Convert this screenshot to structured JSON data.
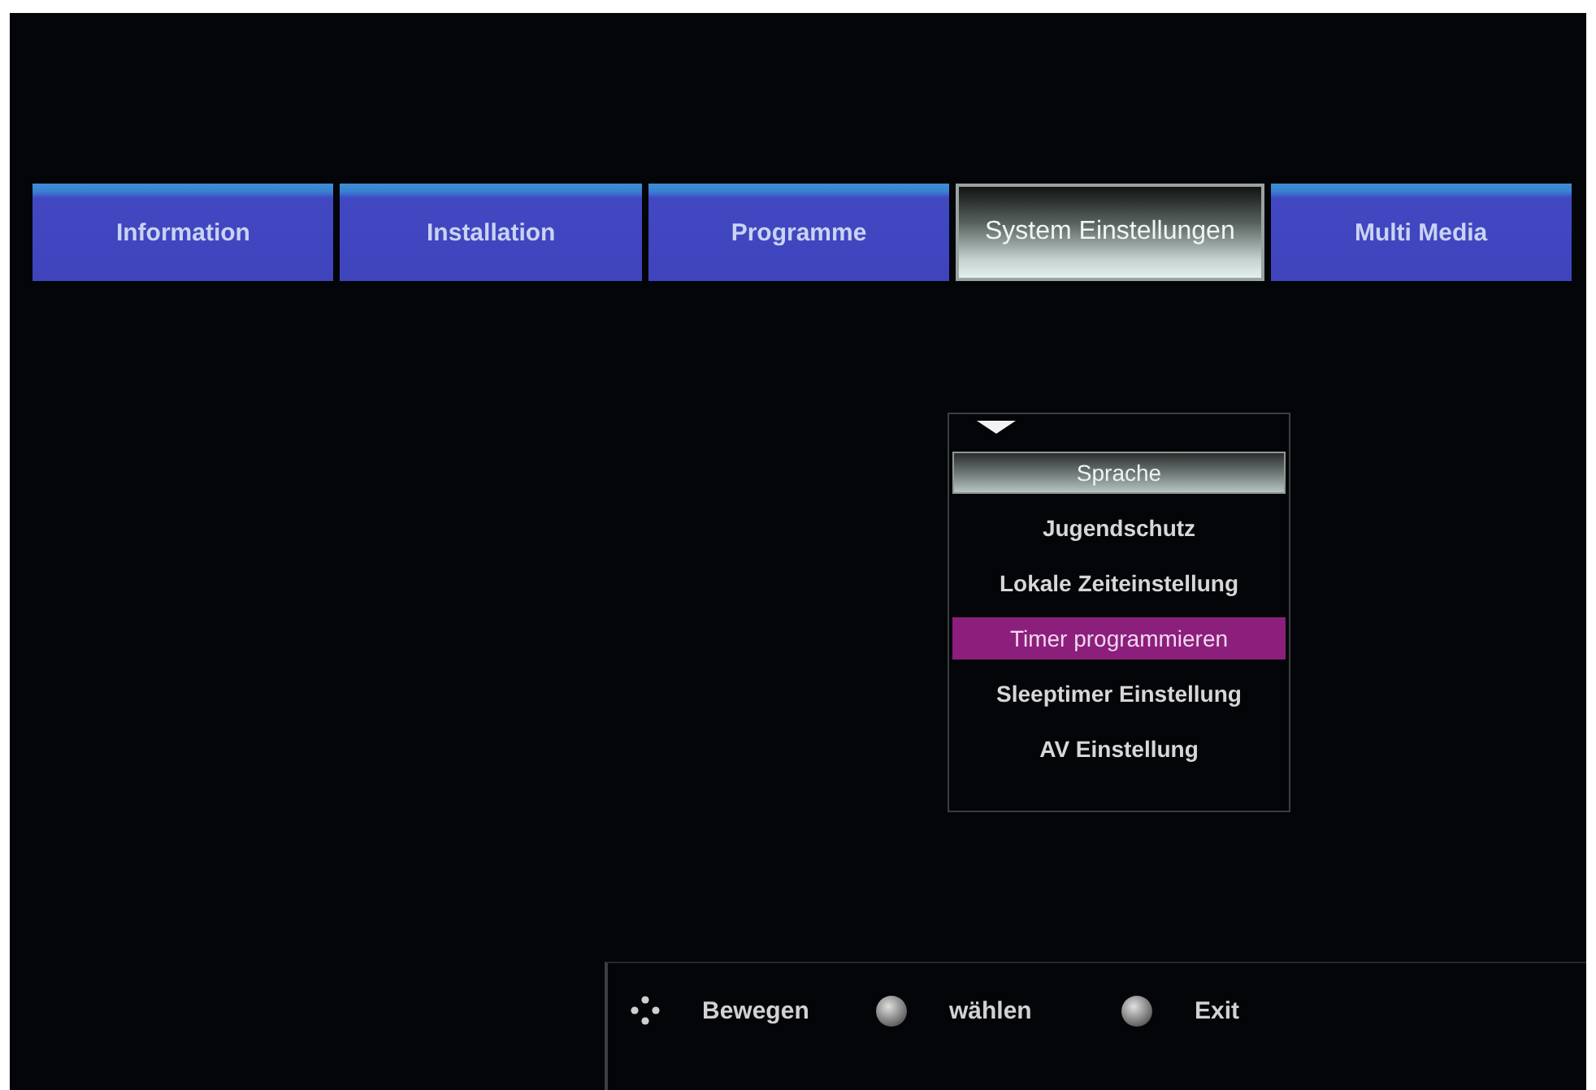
{
  "tabs": [
    {
      "label": "Information",
      "selected": false
    },
    {
      "label": "Installation",
      "selected": false
    },
    {
      "label": "Programme",
      "selected": false
    },
    {
      "label": "System Einstellungen",
      "selected": true
    },
    {
      "label": "Multi Media",
      "selected": false
    }
  ],
  "menu": {
    "items": [
      {
        "label": "Sprache",
        "highlighted": true,
        "selected": false
      },
      {
        "label": "Jugendschutz",
        "highlighted": false,
        "selected": false
      },
      {
        "label": "Lokale Zeiteinstellung",
        "highlighted": false,
        "selected": false
      },
      {
        "label": "Timer programmieren",
        "highlighted": false,
        "selected": true
      },
      {
        "label": "Sleeptimer Einstellung",
        "highlighted": false,
        "selected": false
      },
      {
        "label": "AV Einstellung",
        "highlighted": false,
        "selected": false
      }
    ]
  },
  "hints": [
    {
      "kind": "dpad",
      "label": "Bewegen"
    },
    {
      "kind": "button",
      "label": "wählen"
    },
    {
      "kind": "button",
      "label": "Exit"
    }
  ]
}
